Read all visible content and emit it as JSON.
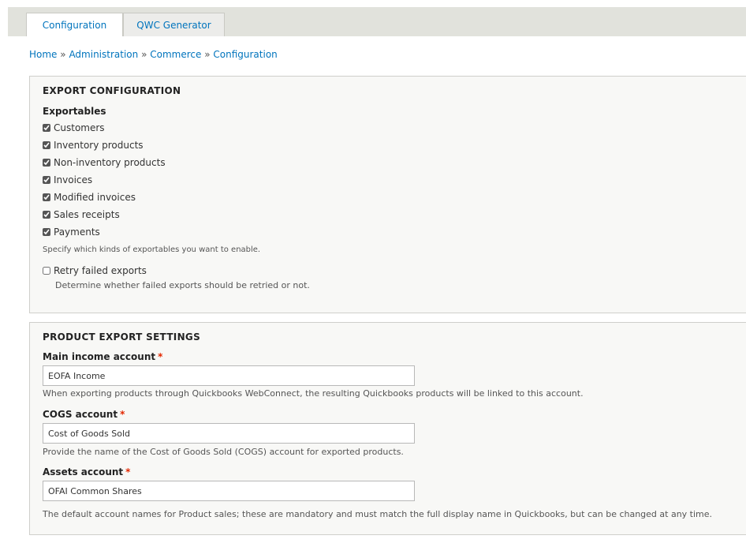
{
  "tabs": [
    {
      "label": "Configuration",
      "active": true
    },
    {
      "label": "QWC Generator",
      "active": false
    }
  ],
  "breadcrumb": [
    "Home",
    "Administration",
    "Commerce",
    "Configuration"
  ],
  "breadcrumb_separator": "»",
  "export_config": {
    "title": "EXPORT CONFIGURATION",
    "exportables_label": "Exportables",
    "items": [
      {
        "label": "Customers",
        "checked": true
      },
      {
        "label": "Inventory products",
        "checked": true
      },
      {
        "label": "Non-inventory products",
        "checked": true
      },
      {
        "label": "Invoices",
        "checked": true
      },
      {
        "label": "Modified invoices",
        "checked": true
      },
      {
        "label": "Sales receipts",
        "checked": true
      },
      {
        "label": "Payments",
        "checked": true
      }
    ],
    "exportables_desc": "Specify which kinds of exportables you want to enable.",
    "retry": {
      "label": "Retry failed exports",
      "checked": false,
      "desc": "Determine whether failed exports should be retried or not."
    }
  },
  "product_export": {
    "title": "PRODUCT EXPORT SETTINGS",
    "required_mark": "*",
    "main_income": {
      "label": "Main income account",
      "value": "EOFA Income",
      "desc": "When exporting products through Quickbooks WebConnect, the resulting Quickbooks products will be linked to this account."
    },
    "cogs": {
      "label": "COGS account",
      "value": "Cost of Goods Sold",
      "desc": "Provide the name of the Cost of Goods Sold (COGS) account for exported products."
    },
    "assets": {
      "label": "Assets account",
      "value": "OFAI Common Shares",
      "desc": "The default account names for Product sales; these are mandatory and must match the full display name in Quickbooks, but can be changed at any time."
    }
  },
  "colors": {
    "link": "#0074bd",
    "required": "#e32700",
    "panel_bg": "#f8f8f6",
    "tabbar_bg": "#e1e2dc"
  }
}
